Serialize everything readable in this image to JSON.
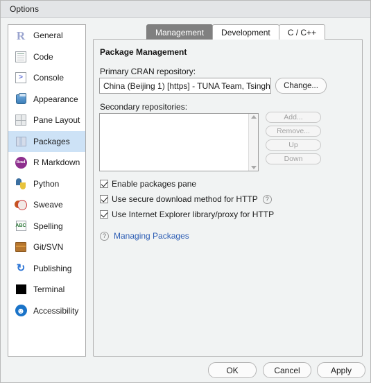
{
  "window": {
    "title": "Options"
  },
  "sidebar": {
    "items": [
      {
        "label": "General",
        "icon": "r-logo-icon",
        "selected": false
      },
      {
        "label": "Code",
        "icon": "code-document-icon",
        "selected": false
      },
      {
        "label": "Console",
        "icon": "console-prompt-icon",
        "selected": false
      },
      {
        "label": "Appearance",
        "icon": "paint-bucket-icon",
        "selected": false
      },
      {
        "label": "Pane Layout",
        "icon": "pane-grid-icon",
        "selected": false
      },
      {
        "label": "Packages",
        "icon": "package-box-icon",
        "selected": true
      },
      {
        "label": "R Markdown",
        "icon": "rmarkdown-icon",
        "selected": false
      },
      {
        "label": "Python",
        "icon": "python-icon",
        "selected": false
      },
      {
        "label": "Sweave",
        "icon": "sweave-pdf-icon",
        "selected": false
      },
      {
        "label": "Spelling",
        "icon": "spellcheck-icon",
        "selected": false
      },
      {
        "label": "Git/SVN",
        "icon": "git-box-icon",
        "selected": false
      },
      {
        "label": "Publishing",
        "icon": "publishing-icon",
        "selected": false
      },
      {
        "label": "Terminal",
        "icon": "terminal-icon",
        "selected": false
      },
      {
        "label": "Accessibility",
        "icon": "accessibility-icon",
        "selected": false
      }
    ]
  },
  "tabs": [
    {
      "label": "Management",
      "active": true
    },
    {
      "label": "Development",
      "active": false
    },
    {
      "label": "C / C++",
      "active": false
    }
  ],
  "main": {
    "section_title": "Package Management",
    "cran": {
      "label": "Primary CRAN repository:",
      "value": "China (Beijing 1) [https] - TUNA Team, Tsingh",
      "change_button": "Change..."
    },
    "secondary": {
      "label": "Secondary repositories:",
      "items": [],
      "buttons": [
        {
          "label": "Add...",
          "disabled": true
        },
        {
          "label": "Remove...",
          "disabled": true
        },
        {
          "label": "Up",
          "disabled": true
        },
        {
          "label": "Down",
          "disabled": true
        }
      ]
    },
    "checkboxes": [
      {
        "label": "Enable packages pane",
        "checked": true,
        "has_help": false
      },
      {
        "label": "Use secure download method for HTTP",
        "checked": true,
        "has_help": true
      },
      {
        "label": "Use Internet Explorer library/proxy for HTTP",
        "checked": true,
        "has_help": false
      }
    ],
    "help_link": {
      "icon": "question-mark-icon",
      "label": "Managing Packages"
    }
  },
  "footer": {
    "ok": "OK",
    "cancel": "Cancel",
    "apply": "Apply"
  },
  "colors": {
    "selection": "#cde2f6",
    "active_tab_bg": "#808080",
    "link": "#2f5fb5",
    "dialog_bg": "#f1f3f3",
    "titlebar_bg": "#e3e5e7"
  }
}
